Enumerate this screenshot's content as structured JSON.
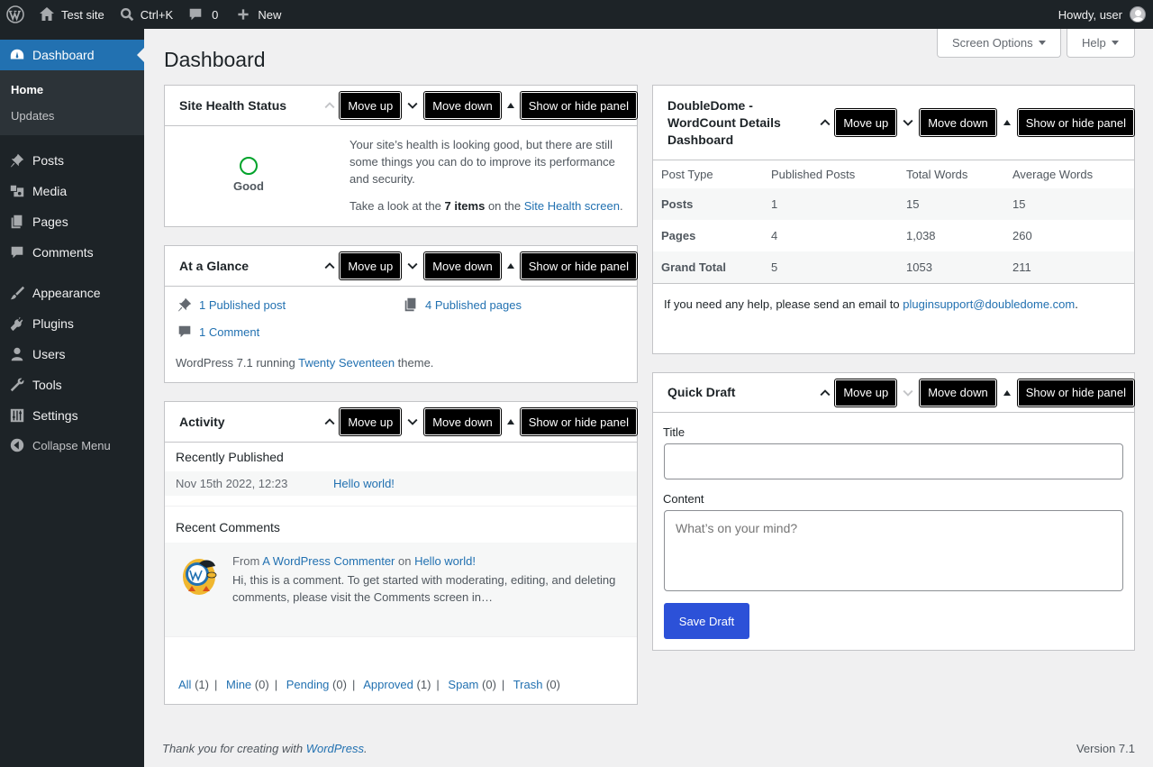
{
  "adminbar": {
    "site_name": "Test site",
    "search_shortcut": "Ctrl+K",
    "comments_count": "0",
    "new_label": "New",
    "howdy": "Howdy, user"
  },
  "sidebar": {
    "dashboard": "Dashboard",
    "sub_home": "Home",
    "sub_updates": "Updates",
    "items": [
      {
        "label": "Posts",
        "icon": "pushpin-icon"
      },
      {
        "label": "Media",
        "icon": "media-icon"
      },
      {
        "label": "Pages",
        "icon": "pages-icon"
      },
      {
        "label": "Comments",
        "icon": "comment-icon"
      },
      {
        "label": "Appearance",
        "icon": "paintbrush-icon"
      },
      {
        "label": "Plugins",
        "icon": "plugin-icon"
      },
      {
        "label": "Users",
        "icon": "user-icon"
      },
      {
        "label": "Tools",
        "icon": "wrench-icon"
      },
      {
        "label": "Settings",
        "icon": "settings-icon"
      }
    ],
    "collapse": "Collapse Menu"
  },
  "header": {
    "title": "Dashboard",
    "screen_options": "Screen Options",
    "help": "Help"
  },
  "controls": {
    "move_up": "Move up",
    "move_down": "Move down",
    "toggle": "Show or hide panel"
  },
  "site_health": {
    "title": "Site Health Status",
    "status": "Good",
    "message": "Your site’s health is looking good, but there are still some things you can do to improve its performance and security.",
    "look_prefix": "Take a look at the ",
    "items": "7 items",
    "look_mid": " on the ",
    "link": "Site Health screen",
    "period": "."
  },
  "glance": {
    "title": "At a Glance",
    "posts": "1 Published post",
    "pages": "4 Published pages",
    "comments": "1 Comment",
    "running_prefix": "WordPress 7.1 running ",
    "theme": "Twenty Seventeen",
    "running_suffix": " theme."
  },
  "activity": {
    "title": "Activity",
    "recently_published": "Recently Published",
    "pub_date": "Nov 15th 2022, 12:23",
    "pub_title": "Hello world!",
    "recent_comments": "Recent Comments",
    "from": "From ",
    "commenter": "A WordPress Commenter",
    "on": " on ",
    "post": "Hello world!",
    "excerpt": "Hi, this is a comment. To get started with moderating, editing, and deleting comments, please visit the Comments screen in…",
    "filters": [
      {
        "label": "All",
        "count": "(1)"
      },
      {
        "label": "Mine",
        "count": "(0)"
      },
      {
        "label": "Pending",
        "count": "(0)"
      },
      {
        "label": "Approved",
        "count": "(1)"
      },
      {
        "label": "Spam",
        "count": "(0)"
      },
      {
        "label": "Trash",
        "count": "(0)"
      }
    ]
  },
  "wordcount": {
    "title_line1": "DoubleDome -",
    "title_line2": "WordCount Details",
    "title_line3": "Dashboard",
    "headers": [
      "Post Type",
      "Published Posts",
      "Total Words",
      "Average Words"
    ],
    "rows": [
      [
        "Posts",
        "1",
        "15",
        "15"
      ],
      [
        "Pages",
        "4",
        "1,038",
        "260"
      ],
      [
        "Grand Total",
        "5",
        "1053",
        "211"
      ]
    ],
    "help_prefix": "If you need any help, please send an email to ",
    "email": "pluginsupport@doubledome.com",
    "help_suffix": "."
  },
  "quick_draft": {
    "title": "Quick Draft",
    "title_label": "Title",
    "title_value": "",
    "content_label": "Content",
    "content_placeholder": "What’s on your mind?",
    "save": "Save Draft"
  },
  "footer": {
    "thanks_prefix": "Thank you for creating with ",
    "wordpress": "WordPress",
    "thanks_suffix": ".",
    "version": "Version 7.1"
  }
}
